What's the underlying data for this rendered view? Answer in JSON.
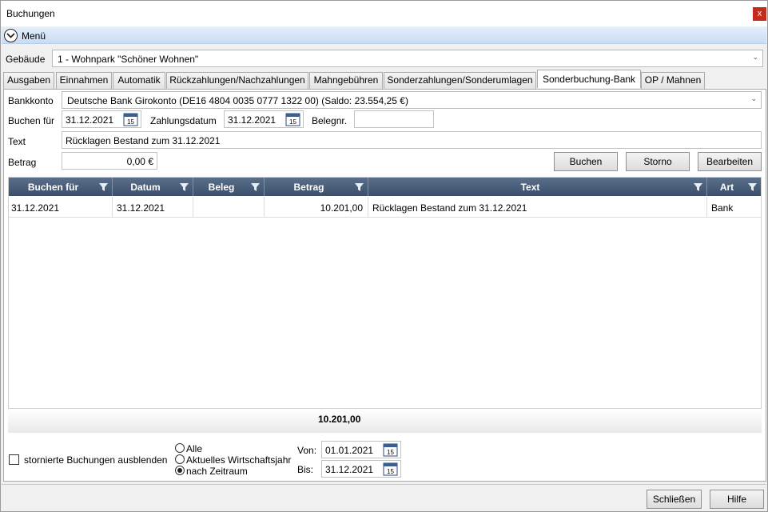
{
  "window": {
    "title": "Buchungen",
    "close_label": "x"
  },
  "menu": {
    "label": "Menü"
  },
  "building": {
    "label": "Gebäude",
    "value": "1 - Wohnpark \"Schöner Wohnen\""
  },
  "tabs": [
    {
      "label": "Ausgaben"
    },
    {
      "label": "Einnahmen"
    },
    {
      "label": "Automatik"
    },
    {
      "label": "Rückzahlungen/Nachzahlungen"
    },
    {
      "label": "Mahngebühren"
    },
    {
      "label": "Sonderzahlungen/Sonderumlagen"
    },
    {
      "label": "Sonderbuchung-Bank",
      "active": true
    },
    {
      "label": "OP / Mahnen"
    }
  ],
  "form": {
    "bank_label": "Bankkonto",
    "bank_value": "Deutsche Bank Girokonto (DE16 4804 0035 0777 1322 00) (Saldo: 23.554,25 €)",
    "book_for_label": "Buchen für",
    "book_for_value": "31.12.2021",
    "payment_date_label": "Zahlungsdatum",
    "payment_date_value": "31.12.2021",
    "receipt_label": "Belegnr.",
    "receipt_value": "",
    "text_label": "Text",
    "text_value": "Rücklagen Bestand zum 31.12.2021",
    "amount_label": "Betrag",
    "amount_value": "0,00 €",
    "calendar_day": "15"
  },
  "actions": {
    "book": "Buchen",
    "cancel": "Storno",
    "edit": "Bearbeiten"
  },
  "grid": {
    "columns": [
      "Buchen für",
      "Datum",
      "Beleg",
      "Betrag",
      "Text",
      "Art"
    ],
    "rows": [
      [
        "31.12.2021",
        "31.12.2021",
        "",
        "10.201,00",
        "Rücklagen Bestand zum 31.12.2021",
        "Bank"
      ]
    ],
    "total": "10.201,00"
  },
  "filters": {
    "hide_cancelled_label": "stornierte Buchungen ausblenden",
    "radio_all": "Alle",
    "radio_year": "Aktuelles Wirtschaftsjahr",
    "radio_period": "nach Zeitraum",
    "from_label": "Von:",
    "from_value": "01.01.2021",
    "to_label": "Bis:",
    "to_value": "31.12.2021"
  },
  "bottom": {
    "close": "Schließen",
    "help": "Hilfe"
  }
}
